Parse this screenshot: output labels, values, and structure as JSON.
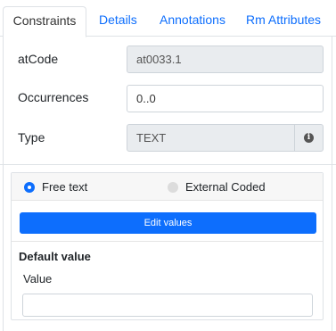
{
  "tabs": [
    {
      "label": "Constraints",
      "active": true
    },
    {
      "label": "Details",
      "active": false
    },
    {
      "label": "Annotations",
      "active": false
    },
    {
      "label": "Rm Attributes",
      "active": false
    }
  ],
  "form": {
    "atcode_label": "atCode",
    "atcode_value": "at0033.1",
    "occurrences_label": "Occurrences",
    "occurrences_value": "0..0",
    "type_label": "Type",
    "type_value": "TEXT",
    "type_info_glyph": "i"
  },
  "text_constraint": {
    "options": [
      {
        "label": "Free text",
        "selected": true
      },
      {
        "label": "External Coded",
        "selected": false
      }
    ],
    "edit_values_label": "Edit values",
    "default_value_title": "Default value",
    "value_label": "Value",
    "value_input": ""
  },
  "colors": {
    "accent": "#0d6efd",
    "disabled_field": "#e9ecef",
    "border": "#dee2e6"
  }
}
